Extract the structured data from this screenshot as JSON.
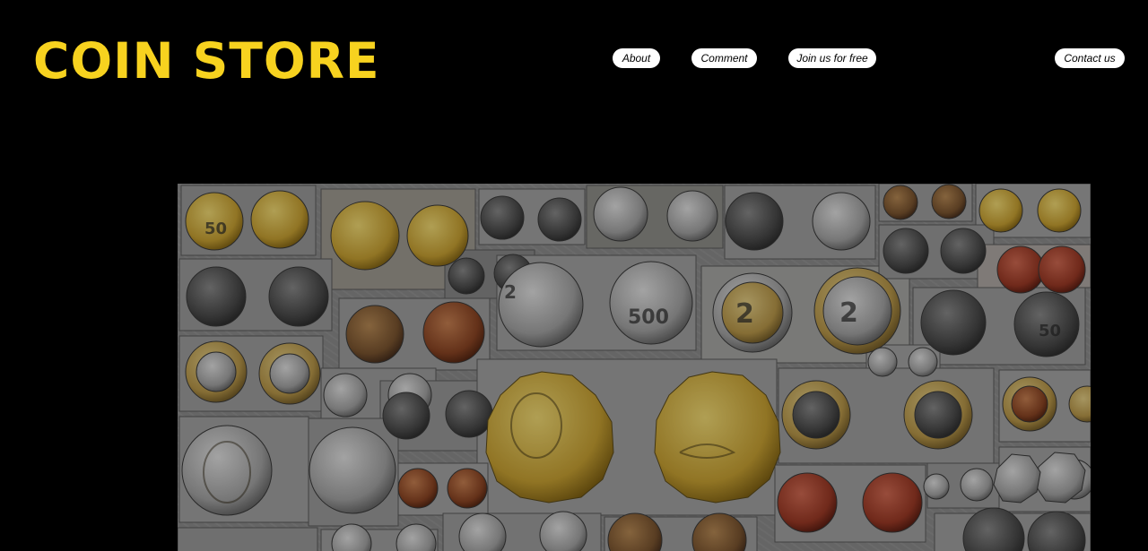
{
  "header": {
    "logo_text": "COIN STORE"
  },
  "nav": {
    "about": "About",
    "comment": "Comment",
    "join": "Join us for free",
    "contact": "Contact us"
  },
  "colors": {
    "background": "#000000",
    "logo": "#f7d21f",
    "nav_button_bg": "#ffffff"
  },
  "hero": {
    "description_icon": "coin-collage-image"
  }
}
